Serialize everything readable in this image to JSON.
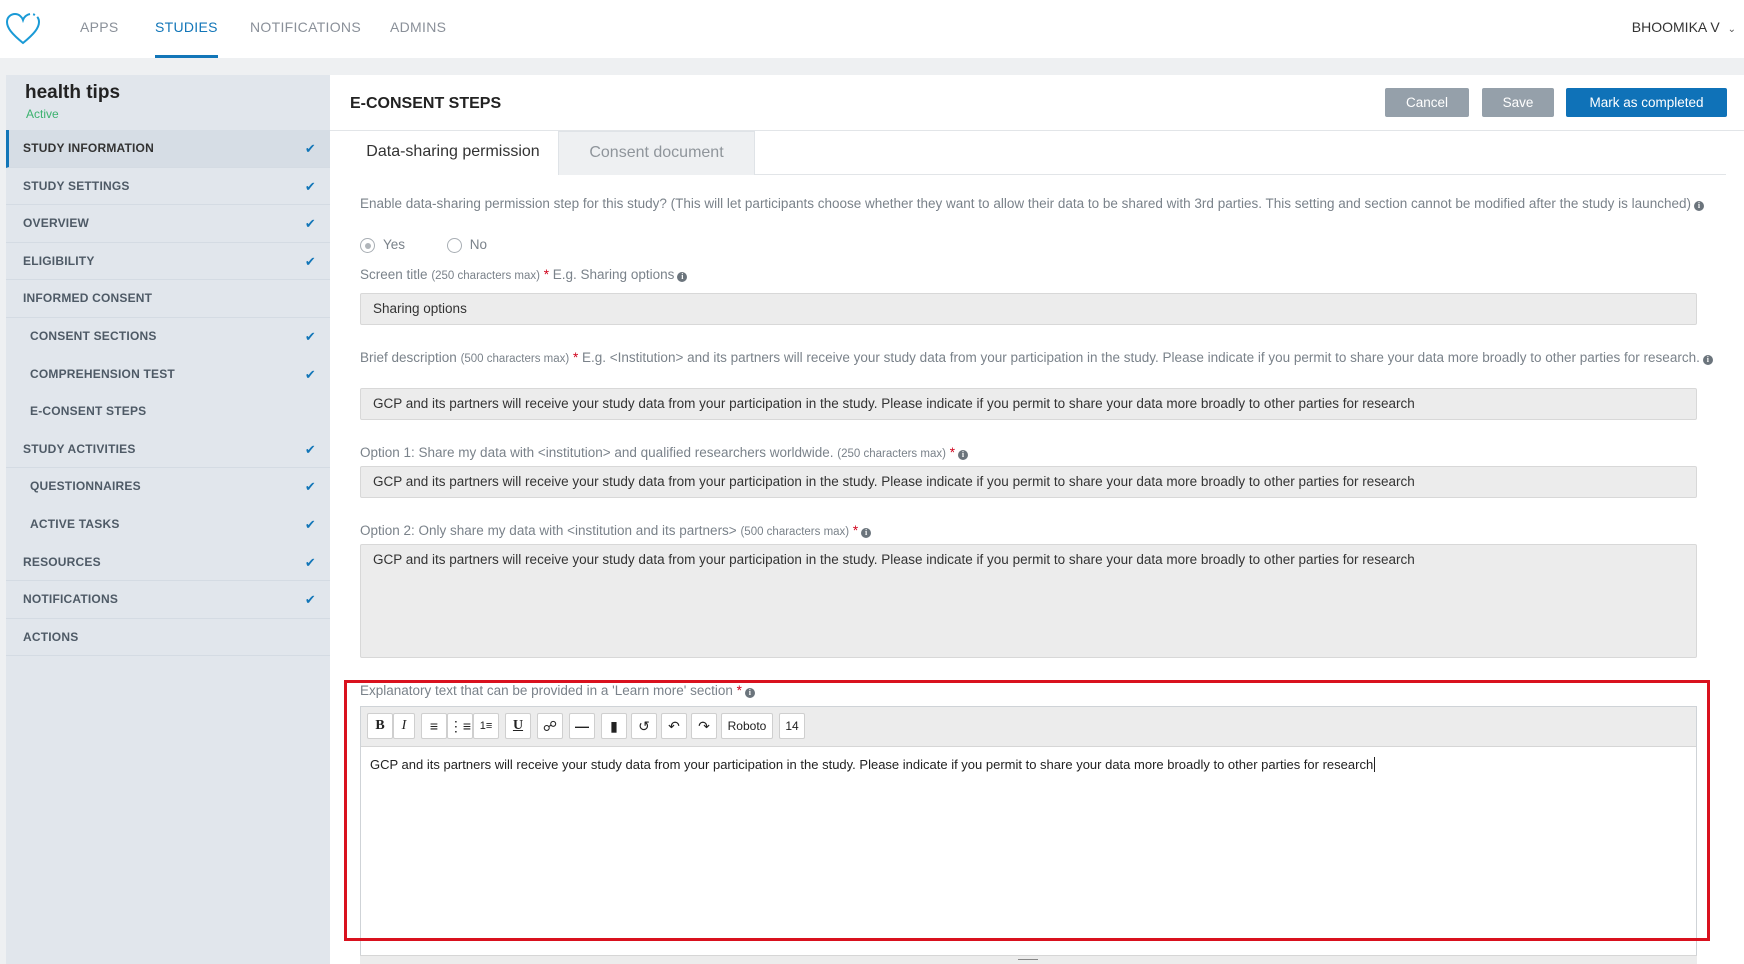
{
  "nav": {
    "tabs": [
      "APPS",
      "STUDIES",
      "NOTIFICATIONS",
      "ADMINS"
    ],
    "active": "STUDIES",
    "user": "BHOOMIKA V"
  },
  "sidebar": {
    "study_name": "health tips",
    "status": "Active",
    "items": [
      {
        "label": "STUDY INFORMATION",
        "checked": true,
        "sub": false,
        "active": true
      },
      {
        "label": "STUDY SETTINGS",
        "checked": true,
        "sub": false
      },
      {
        "label": "OVERVIEW",
        "checked": true,
        "sub": false
      },
      {
        "label": "ELIGIBILITY",
        "checked": true,
        "sub": false
      },
      {
        "label": "INFORMED CONSENT",
        "checked": false,
        "sub": false
      },
      {
        "label": "CONSENT SECTIONS",
        "checked": true,
        "sub": true
      },
      {
        "label": "COMPREHENSION TEST",
        "checked": true,
        "sub": true
      },
      {
        "label": "E-CONSENT STEPS",
        "checked": false,
        "sub": true
      },
      {
        "label": "STUDY ACTIVITIES",
        "checked": true,
        "sub": false
      },
      {
        "label": "QUESTIONNAIRES",
        "checked": true,
        "sub": true
      },
      {
        "label": "ACTIVE TASKS",
        "checked": true,
        "sub": true
      },
      {
        "label": "RESOURCES",
        "checked": true,
        "sub": false
      },
      {
        "label": "NOTIFICATIONS",
        "checked": true,
        "sub": false
      },
      {
        "label": "ACTIONS",
        "checked": false,
        "sub": false
      }
    ]
  },
  "main": {
    "title": "E-CONSENT STEPS",
    "buttons": {
      "cancel": "Cancel",
      "save": "Save",
      "mark": "Mark as completed"
    },
    "tabs": [
      "Data-sharing permission",
      "Consent document"
    ],
    "enable_label": "Enable data-sharing permission step for this study? (This will let participants choose whether they want to allow their data to be shared with 3rd parties. This setting and section cannot be modified after the study is launched)",
    "radio": {
      "yes": "Yes",
      "no": "No",
      "selected": "Yes"
    },
    "screen_title": {
      "label": "Screen title",
      "limit": "(250 characters max)",
      "hint": "E.g. Sharing options",
      "value": "Sharing options"
    },
    "brief": {
      "label": "Brief description",
      "limit": "(500 characters max)",
      "hint": "E.g. <Institution> and its partners will receive your study data from your participation in the study. Please indicate if you permit to share your data more broadly to other parties for research.",
      "value": "GCP and its partners will receive your study data from your participation in the study. Please indicate if you permit to share your data more broadly to other parties for research"
    },
    "option1": {
      "label": "Option 1: Share my data with <institution> and qualified researchers worldwide.",
      "limit": "(250 characters max)",
      "value": "GCP and its partners will receive your study data from your participation in the study. Please indicate if you permit to share your data more broadly to other parties for research"
    },
    "option2": {
      "label": "Option 2: Only share my data with <institution and its partners>",
      "limit": "(500 characters max)",
      "value": "GCP and its partners will receive your study data from your participation in the study. Please indicate if you permit to share your data more broadly to other parties for research"
    },
    "learn_more": {
      "label": "Explanatory text that can be provided in a 'Learn more' section",
      "toolbar": {
        "bold": "B",
        "italic": "I",
        "underline": "U",
        "font": "Roboto",
        "size": "14"
      },
      "value": "GCP and its partners will receive your study data from your participation in the study. Please indicate if you permit to share your data more broadly to other parties for research"
    }
  },
  "colors": {
    "accent": "#1276b8",
    "highlight": "#d9111e",
    "status": "#3bb26e"
  }
}
